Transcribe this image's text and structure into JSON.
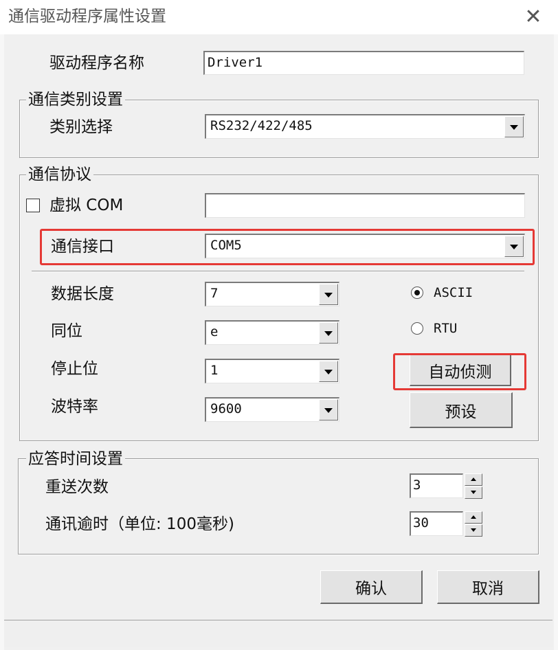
{
  "window": {
    "title": "通信驱动程序属性设置"
  },
  "driver": {
    "label": "驱动程序名称",
    "value": "Driver1"
  },
  "comm_type": {
    "legend": "通信类别设置",
    "label": "类别选择",
    "value": "RS232/422/485"
  },
  "protocol": {
    "legend": "通信协议",
    "virtual_com": {
      "label": "虚拟 COM",
      "checked": false,
      "value": ""
    },
    "port": {
      "label": "通信接口",
      "value": "COM5"
    },
    "data_length": {
      "label": "数据长度",
      "value": "7"
    },
    "parity": {
      "label": "同位",
      "value": "e"
    },
    "stop_bits": {
      "label": "停止位",
      "value": "1"
    },
    "baud_rate": {
      "label": "波特率",
      "value": "9600"
    },
    "mode": {
      "ascii_label": "ASCII",
      "rtu_label": "RTU",
      "selected": "ASCII"
    },
    "auto_detect_label": "自动侦测",
    "preset_label": "预设"
  },
  "response": {
    "legend": "应答时间设置",
    "retry": {
      "label": "重送次数",
      "value": "3"
    },
    "timeout": {
      "label": "通讯逾时（单位: 100毫秒)",
      "value": "30"
    }
  },
  "footer": {
    "ok_label": "确认",
    "cancel_label": "取消"
  },
  "colors": {
    "highlight": "#e53935"
  }
}
